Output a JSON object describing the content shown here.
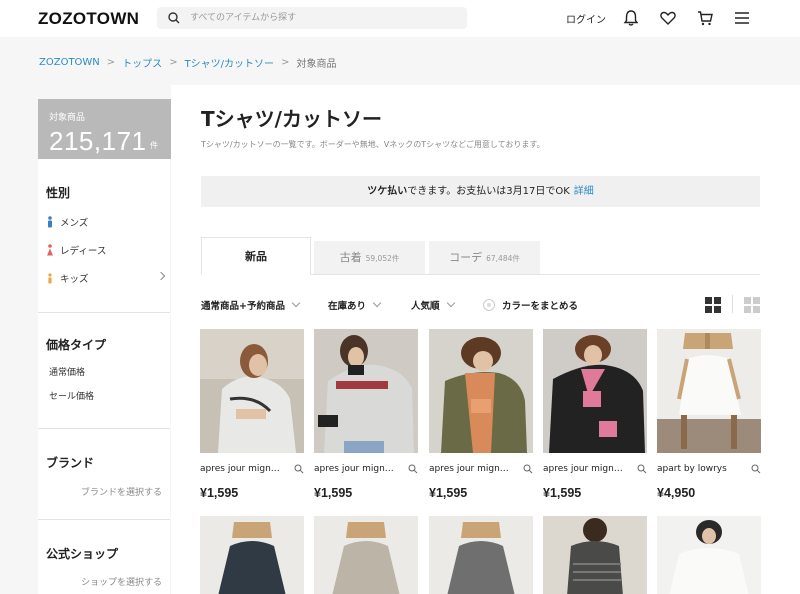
{
  "header": {
    "logo": "ZOZOTOWN",
    "search_placeholder": "すべてのアイテムから探す",
    "login": "ログイン"
  },
  "breadcrumb": [
    "ZOZOTOWN",
    "トップス",
    "Tシャツ/カットソー",
    "対象商品"
  ],
  "count": {
    "label": "対象商品",
    "value": "215,171",
    "unit": "件"
  },
  "sidebar": {
    "gender": {
      "title": "性別",
      "items": [
        "メンズ",
        "レディース",
        "キッズ"
      ]
    },
    "price_type": {
      "title": "価格タイプ",
      "items": [
        "通常価格",
        "セール価格"
      ]
    },
    "brand": {
      "title": "ブランド",
      "link": "ブランドを選択する"
    },
    "shop": {
      "title": "公式ショップ",
      "link": "ショップを選択する"
    }
  },
  "main": {
    "title": "Tシャツ/カットソー",
    "description": "Tシャツ/カットソーの一覧です。ボーダーや無地、VネックのTシャツなどご用意しております。",
    "notice": {
      "bold": "ツケ払い",
      "text": "できます。お支払いは3月17日でOK",
      "link": "詳細"
    },
    "tabs": [
      {
        "label": "新品",
        "count": ""
      },
      {
        "label": "古着",
        "count": "59,052件"
      },
      {
        "label": "コーデ",
        "count": "67,484件"
      }
    ],
    "filters": [
      "通常商品+予約商品",
      "在庫あり",
      "人気順"
    ],
    "color_toggle": "カラーをまとめる"
  },
  "products": [
    {
      "brand": "apres jour mign…",
      "price": "¥1,595"
    },
    {
      "brand": "apres jour mign…",
      "price": "¥1,595"
    },
    {
      "brand": "apres jour mign…",
      "price": "¥1,595"
    },
    {
      "brand": "apres jour mign…",
      "price": "¥1,595"
    },
    {
      "brand": "apart by lowrys",
      "price": "¥4,950"
    }
  ],
  "colors": {
    "link": "#2b8cc4",
    "count_box": "#b9b9b9"
  }
}
